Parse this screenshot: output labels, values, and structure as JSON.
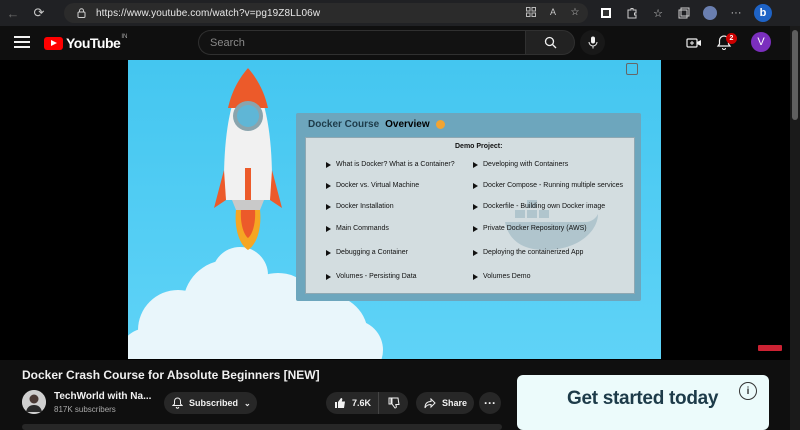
{
  "browser": {
    "url": "https://www.youtube.com/watch?v=pg19Z8LL06w",
    "back_label": "←",
    "reload_label": "⟳"
  },
  "header": {
    "logo_text": "YouTube",
    "country_code": "IN",
    "search_placeholder": "Search",
    "notification_count": "2",
    "avatar_letter": "V"
  },
  "slide": {
    "title_part1": "Docker Course",
    "title_part2": "Overview",
    "demo_heading": "Demo Project:",
    "left_topics": [
      "What is Docker? What is a Container?",
      "Docker vs. Virtual Machine",
      "Docker Installation",
      "Main Commands",
      "Debugging a Container",
      "Volumes - Persisting Data"
    ],
    "right_topics": [
      "Developing with Containers",
      "Docker Compose - Running multiple services",
      "Dockerfile - Building own Docker image",
      "Private Docker Repository (AWS)",
      "Deploying the containerized App",
      "Volumes Demo"
    ]
  },
  "video": {
    "title": "Docker Crash Course for Absolute Beginners [NEW]",
    "channel_name": "TechWorld with Na...",
    "subscribers": "817K subscribers",
    "subscribed_label": "Subscribed",
    "likes": "7.6K",
    "share_label": "Share",
    "more_label": "···"
  },
  "ad": {
    "text": "Get started today",
    "info_label": "i"
  },
  "colors": {
    "brand_red": "#ff0000",
    "video_bg": "#44c6f0",
    "ad_bg": "#ecfbfb"
  }
}
